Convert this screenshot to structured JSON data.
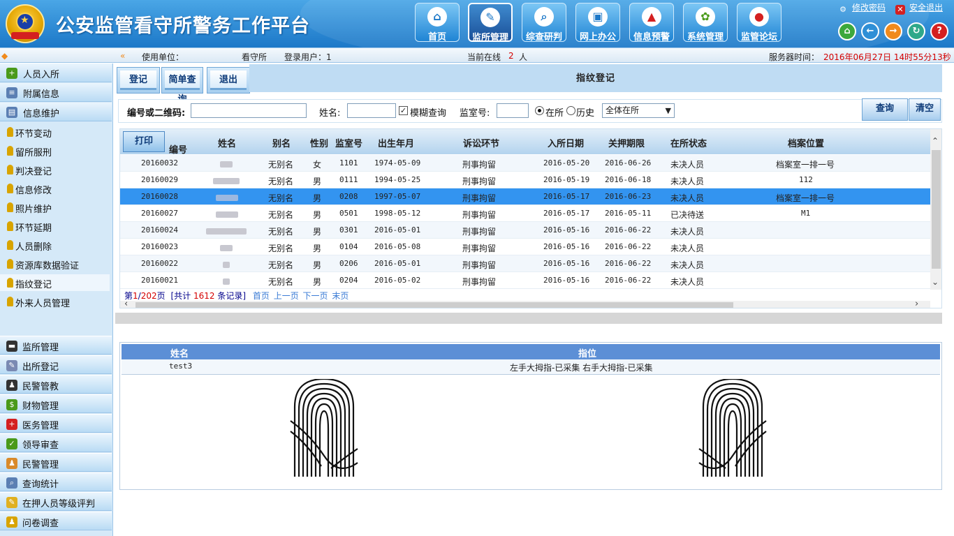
{
  "app": {
    "title": "公安监管看守所警务工作平台"
  },
  "nav": [
    {
      "label": "首页",
      "icon": "home-icon"
    },
    {
      "label": "监所管理",
      "icon": "feather-icon"
    },
    {
      "label": "综查研判",
      "icon": "magnifier-icon"
    },
    {
      "label": "网上办公",
      "icon": "computer-icon"
    },
    {
      "label": "信息预警",
      "icon": "alarm-icon"
    },
    {
      "label": "系统管理",
      "icon": "gear-icon"
    },
    {
      "label": "监管论坛",
      "icon": "forum-icon"
    }
  ],
  "toplinks": {
    "change_password": "修改密码",
    "logout": "安全退出"
  },
  "infobar": {
    "unit_label": "使用单位：",
    "unit_value": "看守所",
    "user_label": "登录用户：1",
    "online_label": "当前在线",
    "online_count": "2",
    "online_unit": "人",
    "server_time_label": "服务器时间：",
    "server_time": "2016年06月27日 14时55分13秒"
  },
  "sidebar": {
    "top": [
      {
        "label": "人员入所"
      },
      {
        "label": "附属信息"
      },
      {
        "label": "信息维护"
      }
    ],
    "sub": [
      {
        "label": "环节变动"
      },
      {
        "label": "留所服刑"
      },
      {
        "label": "判决登记"
      },
      {
        "label": "信息修改"
      },
      {
        "label": "照片维护"
      },
      {
        "label": "环节延期"
      },
      {
        "label": "人员删除"
      },
      {
        "label": "资源库数据验证"
      },
      {
        "label": "指纹登记"
      },
      {
        "label": "外来人员管理"
      }
    ],
    "bottom": [
      {
        "label": "监所管理"
      },
      {
        "label": "出所登记"
      },
      {
        "label": "民警管教"
      },
      {
        "label": "财物管理"
      },
      {
        "label": "医务管理"
      },
      {
        "label": "领导审查"
      },
      {
        "label": "民警管理"
      },
      {
        "label": "查询统计"
      },
      {
        "label": "在押人员等级评判"
      },
      {
        "label": "问卷调查"
      }
    ]
  },
  "toolbar": {
    "register": "登记",
    "simple_query": "简单查询",
    "exit": "退出"
  },
  "form_title": "指纹登记",
  "search": {
    "code_label": "编号或二维码:",
    "name_label": "姓名:",
    "fuzzy_label": "模糊查询",
    "fuzzy_checked": "✓",
    "room_label": "监室号:",
    "in_label": "在所",
    "history_label": "历史",
    "scope_value": "全体在所",
    "query_button": "查询",
    "clear_button": "清空"
  },
  "table": {
    "print": "打印",
    "columns": [
      "编号",
      "姓名",
      "别名",
      "性别",
      "监室号",
      "出生年月",
      "诉讼环节",
      "入所日期",
      "关押期限",
      "在所状态",
      "档案位置"
    ],
    "rows": [
      {
        "id": "20160032",
        "alias": "无别名",
        "sex": "女",
        "room": "1101",
        "birth": "1974-05-09",
        "stage": "刑事拘留",
        "in_date": "2016-05-20",
        "limit": "2016-06-26",
        "status": "未决人员",
        "archive": "档案室一排一号"
      },
      {
        "id": "20160029",
        "alias": "无别名",
        "sex": "男",
        "room": "0111",
        "birth": "1994-05-25",
        "stage": "刑事拘留",
        "in_date": "2016-05-19",
        "limit": "2016-06-18",
        "status": "未决人员",
        "archive": "112"
      },
      {
        "id": "20160028",
        "alias": "无别名",
        "sex": "男",
        "room": "0208",
        "birth": "1997-05-07",
        "stage": "刑事拘留",
        "in_date": "2016-05-17",
        "limit": "2016-06-23",
        "status": "未决人员",
        "archive": "档案室一排一号"
      },
      {
        "id": "20160027",
        "alias": "无别名",
        "sex": "男",
        "room": "0501",
        "birth": "1998-05-12",
        "stage": "刑事拘留",
        "in_date": "2016-05-17",
        "limit": "2016-05-11",
        "status": "已决待送",
        "archive": "M1"
      },
      {
        "id": "20160024",
        "alias": "无别名",
        "sex": "男",
        "room": "0301",
        "birth": "2016-05-01",
        "stage": "刑事拘留",
        "in_date": "2016-05-16",
        "limit": "2016-06-22",
        "status": "未决人员",
        "archive": ""
      },
      {
        "id": "20160023",
        "alias": "无别名",
        "sex": "男",
        "room": "0104",
        "birth": "2016-05-08",
        "stage": "刑事拘留",
        "in_date": "2016-05-16",
        "limit": "2016-06-22",
        "status": "未决人员",
        "archive": ""
      },
      {
        "id": "20160022",
        "alias": "无别名",
        "sex": "男",
        "room": "0206",
        "birth": "2016-05-01",
        "stage": "刑事拘留",
        "in_date": "2016-05-16",
        "limit": "2016-06-22",
        "status": "未决人员",
        "archive": ""
      },
      {
        "id": "20160021",
        "alias": "无别名",
        "sex": "男",
        "room": "0204",
        "birth": "2016-05-02",
        "stage": "刑事拘留",
        "in_date": "2016-05-16",
        "limit": "2016-06-22",
        "status": "未决人员",
        "archive": ""
      }
    ]
  },
  "pager": {
    "page_prefix": "第",
    "page_current": "1",
    "page_sep": "/",
    "page_total": "202",
    "page_suffix": "页",
    "total_prefix": "[共计",
    "total_count": "1612",
    "total_suffix": "条记录]",
    "first": "首页",
    "prev": "上一页",
    "next": "下一页",
    "last": "末页"
  },
  "fingerprint": {
    "col_name": "姓名",
    "col_finger": "指位",
    "name": "test3",
    "finger_status": "左手大拇指-已采集 右手大拇指-已采集"
  },
  "colors": {
    "accent": "#1c78c8",
    "selected_row": "#3394f0",
    "panel_header": "#5c8fd6",
    "highlight_red": "#d40000"
  }
}
